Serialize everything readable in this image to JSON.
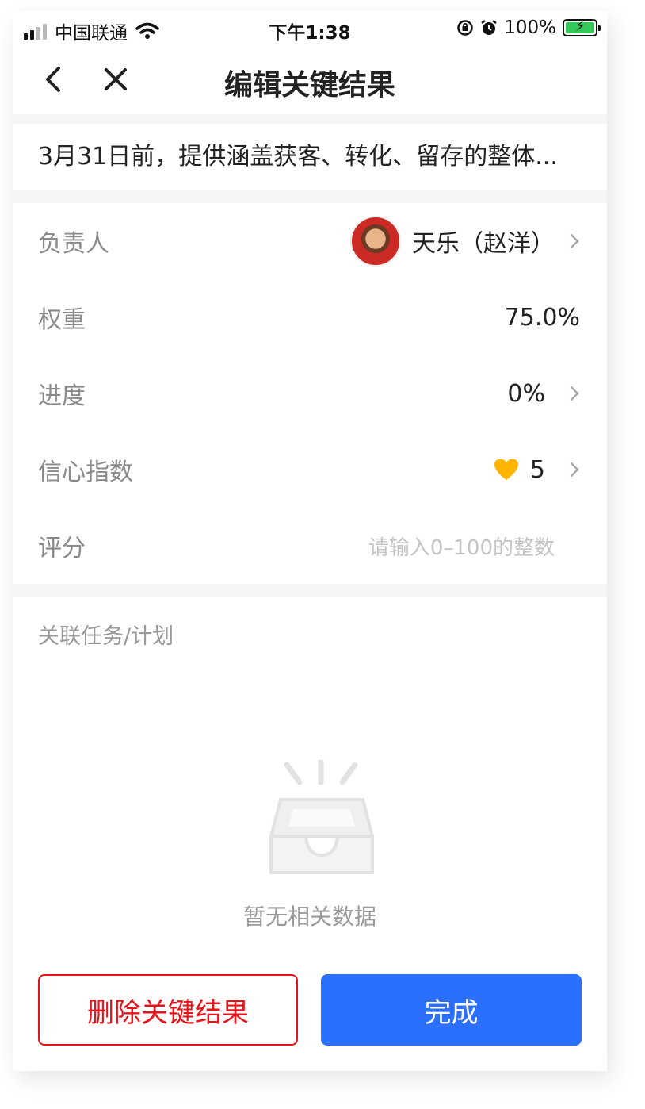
{
  "status_bar": {
    "carrier": "中国联通",
    "time": "下午1:38",
    "battery": "100%",
    "battery_level": 1.0
  },
  "nav": {
    "title": "编辑关键结果"
  },
  "kr": {
    "title": "3月31日前，提供涵盖获客、转化、留存的整体..."
  },
  "fields": {
    "owner_label": "负责人",
    "owner_value": "天乐（赵洋）",
    "weight_label": "权重",
    "weight_value": "75.0%",
    "progress_label": "进度",
    "progress_value": "0%",
    "confidence_label": "信心指数",
    "confidence_value": "5",
    "score_label": "评分",
    "score_placeholder": "请输入0–100的整数"
  },
  "related": {
    "label": "关联任务/计划",
    "empty_text": "暂无相关数据"
  },
  "actions": {
    "delete_label": "删除关键结果",
    "done_label": "完成"
  },
  "colors": {
    "accent": "#2b6ffd",
    "danger": "#e7131b",
    "confidence_heart": "#ffb400"
  },
  "icons": [
    "signal-icon",
    "wifi-icon",
    "orientation-lock-icon",
    "alarm-icon",
    "battery-icon",
    "back-icon",
    "close-icon",
    "chevron-right-icon",
    "heart-icon",
    "empty-box-icon"
  ]
}
